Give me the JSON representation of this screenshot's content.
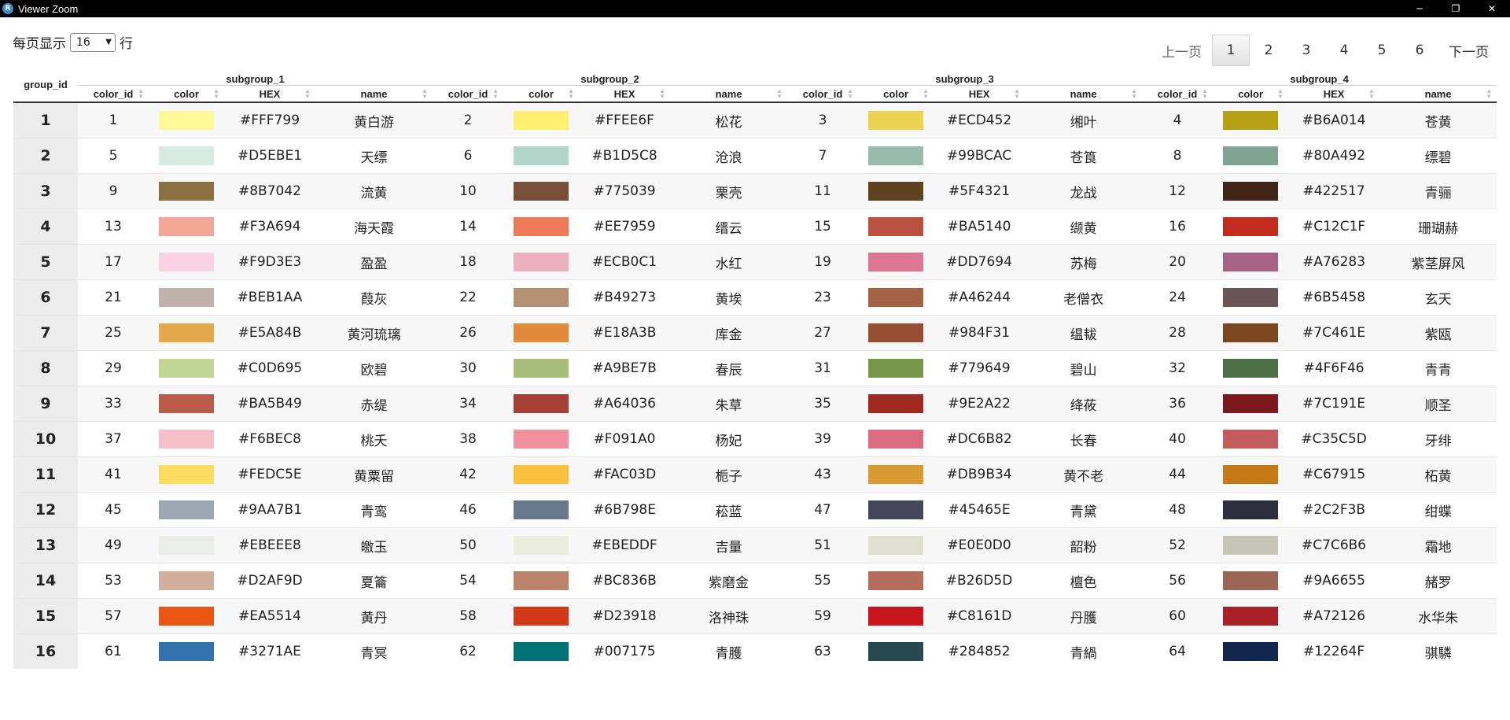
{
  "window": {
    "title": "Viewer Zoom",
    "icon": "r-app-icon"
  },
  "page_size": {
    "prefix": "每页显示",
    "value": "16",
    "suffix": "行"
  },
  "pager": {
    "prev": "上一页",
    "next": "下一页",
    "pages": [
      "1",
      "2",
      "3",
      "4",
      "5",
      "6"
    ],
    "current": "1"
  },
  "table": {
    "group_header": "group_id",
    "subgroups": [
      "subgroup_1",
      "subgroup_2",
      "subgroup_3",
      "subgroup_4"
    ],
    "columns": [
      "color_id",
      "color",
      "HEX",
      "name"
    ],
    "rows": [
      {
        "group_id": "1",
        "cells": [
          {
            "color_id": "1",
            "hex": "#FFF799",
            "name": "黄白游"
          },
          {
            "color_id": "2",
            "hex": "#FFEE6F",
            "name": "松花"
          },
          {
            "color_id": "3",
            "hex": "#ECD452",
            "name": "缃叶"
          },
          {
            "color_id": "4",
            "hex": "#B6A014",
            "name": "苍黄"
          }
        ]
      },
      {
        "group_id": "2",
        "cells": [
          {
            "color_id": "5",
            "hex": "#D5EBE1",
            "name": "天缥"
          },
          {
            "color_id": "6",
            "hex": "#B1D5C8",
            "name": "沧浪"
          },
          {
            "color_id": "7",
            "hex": "#99BCAC",
            "name": "苍筤"
          },
          {
            "color_id": "8",
            "hex": "#80A492",
            "name": "缥碧"
          }
        ]
      },
      {
        "group_id": "3",
        "cells": [
          {
            "color_id": "9",
            "hex": "#8B7042",
            "name": "流黄"
          },
          {
            "color_id": "10",
            "hex": "#775039",
            "name": "栗壳"
          },
          {
            "color_id": "11",
            "hex": "#5F4321",
            "name": "龙战"
          },
          {
            "color_id": "12",
            "hex": "#422517",
            "name": "青骊"
          }
        ]
      },
      {
        "group_id": "4",
        "cells": [
          {
            "color_id": "13",
            "hex": "#F3A694",
            "name": "海天霞"
          },
          {
            "color_id": "14",
            "hex": "#EE7959",
            "name": "缙云"
          },
          {
            "color_id": "15",
            "hex": "#BA5140",
            "name": "缬黄"
          },
          {
            "color_id": "16",
            "hex": "#C12C1F",
            "name": "珊瑚赫"
          }
        ]
      },
      {
        "group_id": "5",
        "cells": [
          {
            "color_id": "17",
            "hex": "#F9D3E3",
            "name": "盈盈"
          },
          {
            "color_id": "18",
            "hex": "#ECB0C1",
            "name": "水红"
          },
          {
            "color_id": "19",
            "hex": "#DD7694",
            "name": "苏梅"
          },
          {
            "color_id": "20",
            "hex": "#A76283",
            "name": "紫茎屏风"
          }
        ]
      },
      {
        "group_id": "6",
        "cells": [
          {
            "color_id": "21",
            "hex": "#BEB1AA",
            "name": "葭灰"
          },
          {
            "color_id": "22",
            "hex": "#B49273",
            "name": "黄埃"
          },
          {
            "color_id": "23",
            "hex": "#A46244",
            "name": "老僧衣"
          },
          {
            "color_id": "24",
            "hex": "#6B5458",
            "name": "玄天"
          }
        ]
      },
      {
        "group_id": "7",
        "cells": [
          {
            "color_id": "25",
            "hex": "#E5A84B",
            "name": "黄河琉璃"
          },
          {
            "color_id": "26",
            "hex": "#E18A3B",
            "name": "库金"
          },
          {
            "color_id": "27",
            "hex": "#984F31",
            "name": "缊韨"
          },
          {
            "color_id": "28",
            "hex": "#7C461E",
            "name": "紫瓯"
          }
        ]
      },
      {
        "group_id": "8",
        "cells": [
          {
            "color_id": "29",
            "hex": "#C0D695",
            "name": "欧碧"
          },
          {
            "color_id": "30",
            "hex": "#A9BE7B",
            "name": "春辰"
          },
          {
            "color_id": "31",
            "hex": "#779649",
            "name": "碧山"
          },
          {
            "color_id": "32",
            "hex": "#4F6F46",
            "name": "青青"
          }
        ]
      },
      {
        "group_id": "9",
        "cells": [
          {
            "color_id": "33",
            "hex": "#BA5B49",
            "name": "赤缇"
          },
          {
            "color_id": "34",
            "hex": "#A64036",
            "name": "朱草"
          },
          {
            "color_id": "35",
            "hex": "#9E2A22",
            "name": "绛莜"
          },
          {
            "color_id": "36",
            "hex": "#7C191E",
            "name": "顺圣"
          }
        ]
      },
      {
        "group_id": "10",
        "cells": [
          {
            "color_id": "37",
            "hex": "#F6BEC8",
            "name": "桃夭"
          },
          {
            "color_id": "38",
            "hex": "#F091A0",
            "name": "杨妃"
          },
          {
            "color_id": "39",
            "hex": "#DC6B82",
            "name": "长春"
          },
          {
            "color_id": "40",
            "hex": "#C35C5D",
            "name": "牙绯"
          }
        ]
      },
      {
        "group_id": "11",
        "cells": [
          {
            "color_id": "41",
            "hex": "#FEDC5E",
            "name": "黄粟留"
          },
          {
            "color_id": "42",
            "hex": "#FAC03D",
            "name": "栀子"
          },
          {
            "color_id": "43",
            "hex": "#DB9B34",
            "name": "黄不老"
          },
          {
            "color_id": "44",
            "hex": "#C67915",
            "name": "柘黄"
          }
        ]
      },
      {
        "group_id": "12",
        "cells": [
          {
            "color_id": "45",
            "hex": "#9AA7B1",
            "name": "青鸾"
          },
          {
            "color_id": "46",
            "hex": "#6B798E",
            "name": "菘蓝"
          },
          {
            "color_id": "47",
            "hex": "#45465E",
            "name": "青黛"
          },
          {
            "color_id": "48",
            "hex": "#2C2F3B",
            "name": "绀蝶"
          }
        ]
      },
      {
        "group_id": "13",
        "cells": [
          {
            "color_id": "49",
            "hex": "#EBEEE8",
            "name": "皦玉"
          },
          {
            "color_id": "50",
            "hex": "#EBEDDF",
            "name": "吉量"
          },
          {
            "color_id": "51",
            "hex": "#E0E0D0",
            "name": "韶粉"
          },
          {
            "color_id": "52",
            "hex": "#C7C6B6",
            "name": "霜地"
          }
        ]
      },
      {
        "group_id": "14",
        "cells": [
          {
            "color_id": "53",
            "hex": "#D2AF9D",
            "name": "夏籥"
          },
          {
            "color_id": "54",
            "hex": "#BC836B",
            "name": "紫磨金"
          },
          {
            "color_id": "55",
            "hex": "#B26D5D",
            "name": "檀色"
          },
          {
            "color_id": "56",
            "hex": "#9A6655",
            "name": "赭罗"
          }
        ]
      },
      {
        "group_id": "15",
        "cells": [
          {
            "color_id": "57",
            "hex": "#EA5514",
            "name": "黄丹"
          },
          {
            "color_id": "58",
            "hex": "#D23918",
            "name": "洛神珠"
          },
          {
            "color_id": "59",
            "hex": "#C8161D",
            "name": "丹臒"
          },
          {
            "color_id": "60",
            "hex": "#A72126",
            "name": "水华朱"
          }
        ]
      },
      {
        "group_id": "16",
        "cells": [
          {
            "color_id": "61",
            "hex": "#3271AE",
            "name": "青冥"
          },
          {
            "color_id": "62",
            "hex": "#007175",
            "name": "青臒"
          },
          {
            "color_id": "63",
            "hex": "#284852",
            "name": "青緺"
          },
          {
            "color_id": "64",
            "hex": "#12264F",
            "name": "骐驎"
          }
        ]
      }
    ]
  }
}
